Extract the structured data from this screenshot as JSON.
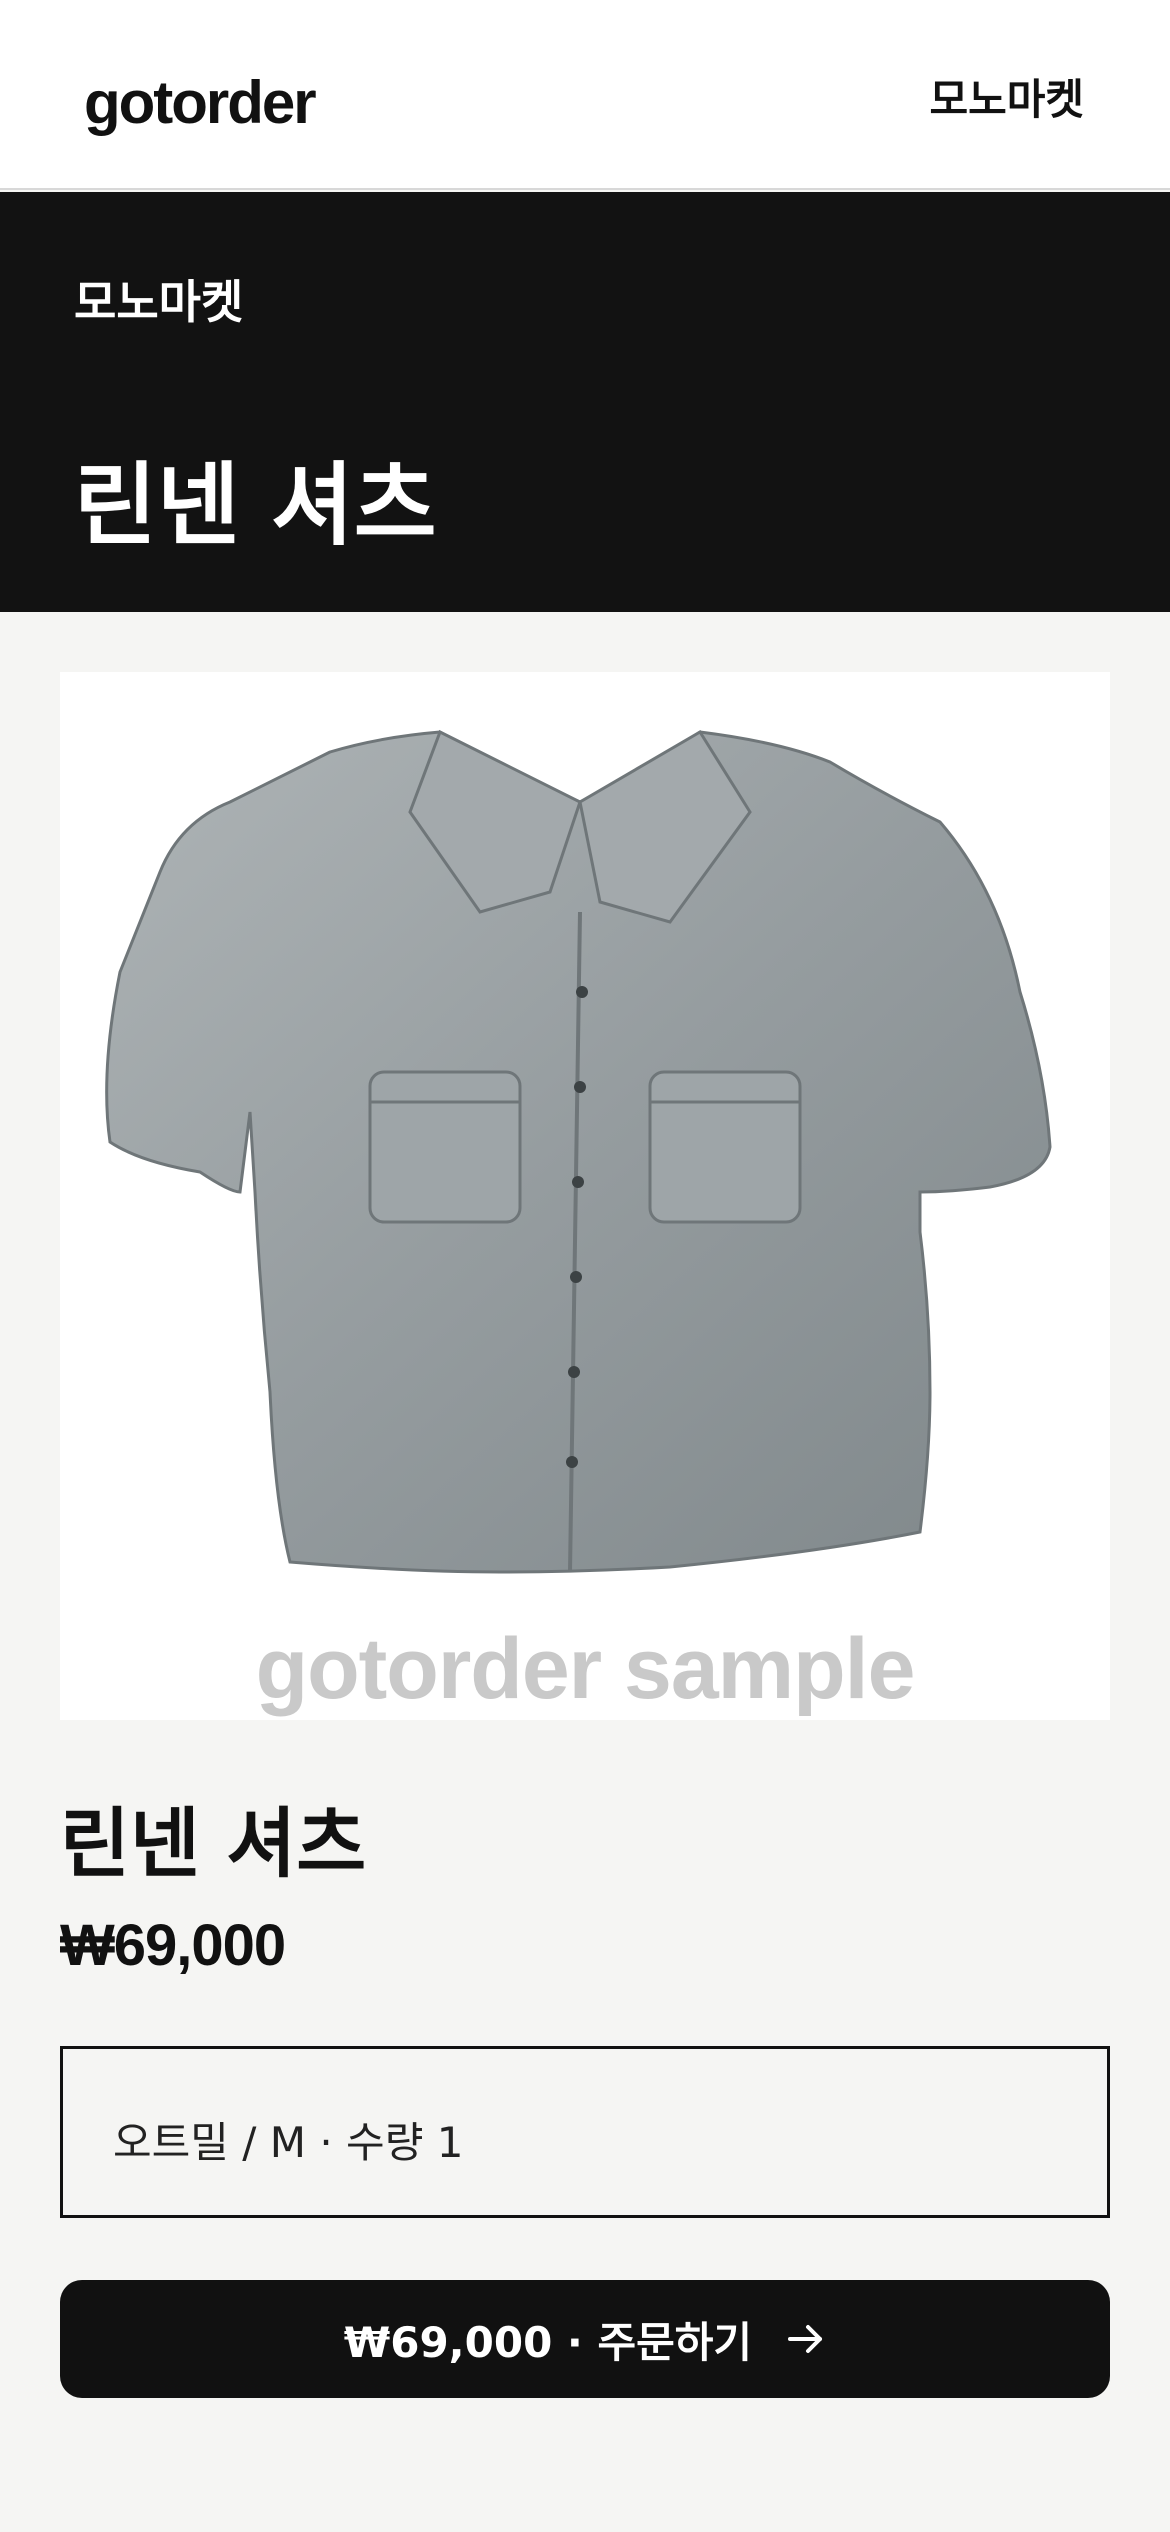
{
  "header": {
    "logo": "gotorder",
    "store_link": "모노마켓"
  },
  "hero": {
    "store_name": "모노마켓",
    "title": "린넨 셔츠"
  },
  "product": {
    "image_icon": "shirt-photo",
    "watermark": "gotorder sample",
    "name": "린넨 셔츠",
    "price": "₩69,000",
    "selected_option": "오트밀 / M · 수량 1"
  },
  "order_button": {
    "label": "₩69,000 · 주문하기",
    "icon": "arrow-right-icon"
  },
  "colors": {
    "background": "#f5f5f3",
    "hero": "#121212",
    "accent": "#111111",
    "watermark": "#c9c9c9",
    "shirt": "#9aa1a4"
  }
}
